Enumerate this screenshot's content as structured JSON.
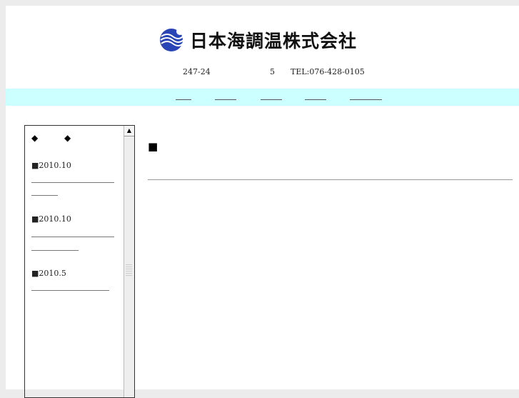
{
  "header": {
    "company_name": "日本海調温株式会社",
    "address_part1": "247-24",
    "address_part2": "5",
    "phone": "TEL:076-428-0105"
  },
  "nav": {
    "links": [
      "",
      "",
      "",
      "",
      ""
    ]
  },
  "sidebar": {
    "bullets": [
      "◆",
      "◆"
    ],
    "news": [
      {
        "date": "■2010.10"
      },
      {
        "date": "■2010.10"
      },
      {
        "date": "■2010.5"
      }
    ]
  },
  "content": {
    "heading_mark": "■"
  },
  "colors": {
    "nav_bg": "#ccffff",
    "logo_blue": "#2244aa"
  }
}
